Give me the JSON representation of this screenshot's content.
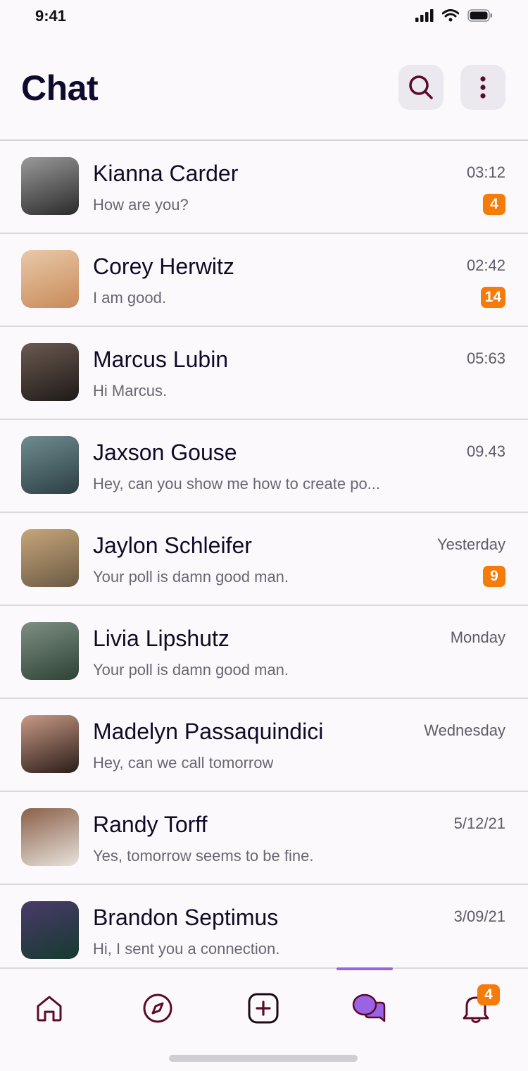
{
  "status_bar": {
    "time": "9:41"
  },
  "header": {
    "title": "Chat",
    "search_icon": "search-icon",
    "more_icon": "more-vertical-icon"
  },
  "chats": [
    {
      "name": "Kianna Carder",
      "message": "How are you?",
      "time": "03:12",
      "unread": "4",
      "avatar_colors": [
        "#2a2a2a",
        "#9a9a9a"
      ]
    },
    {
      "name": "Corey Herwitz",
      "message": "I am good.",
      "time": "02:42",
      "unread": "14",
      "avatar_colors": [
        "#c98a5a",
        "#e8c9a8"
      ]
    },
    {
      "name": "Marcus Lubin",
      "message": "Hi Marcus.",
      "time": "05:63",
      "unread": "",
      "avatar_colors": [
        "#1e1a18",
        "#6b5a50"
      ]
    },
    {
      "name": "Jaxson Gouse",
      "message": "Hey, can you show me how to create po...",
      "time": "09.43",
      "unread": "",
      "avatar_colors": [
        "#2c3f44",
        "#6f8c8e"
      ]
    },
    {
      "name": "Jaylon Schleifer",
      "message": "Your poll is damn good man.",
      "time": "Yesterday",
      "unread": "9",
      "avatar_colors": [
        "#6b5a44",
        "#c7a67a"
      ]
    },
    {
      "name": "Livia Lipshutz",
      "message": "Your poll is damn good man.",
      "time": "Monday",
      "unread": "",
      "avatar_colors": [
        "#2e4236",
        "#7d8f82"
      ]
    },
    {
      "name": "Madelyn Passaquindici",
      "message": "Hey, can we call tomorrow",
      "time": "Wednesday",
      "unread": "",
      "avatar_colors": [
        "#2a1c18",
        "#c89a86"
      ]
    },
    {
      "name": "Randy Torff",
      "message": "Yes, tomorrow seems to be fine.",
      "time": "5/12/21",
      "unread": "",
      "avatar_colors": [
        "#e8e2dc",
        "#8a6048"
      ]
    },
    {
      "name": "Brandon Septimus",
      "message": "Hi, I sent you a connection.",
      "time": "3/09/21",
      "unread": "",
      "avatar_colors": [
        "#163a30",
        "#4a3a6a"
      ]
    }
  ],
  "tabbar": {
    "items": [
      "home-icon",
      "compass-icon",
      "add-square-icon",
      "chat-bubbles-icon",
      "bell-icon"
    ],
    "active": "chat-bubbles-icon",
    "notification_count": "4"
  },
  "colors": {
    "accent": "#9a63e4",
    "badge": "#f57b0b",
    "icon": "#5b0a2a"
  }
}
